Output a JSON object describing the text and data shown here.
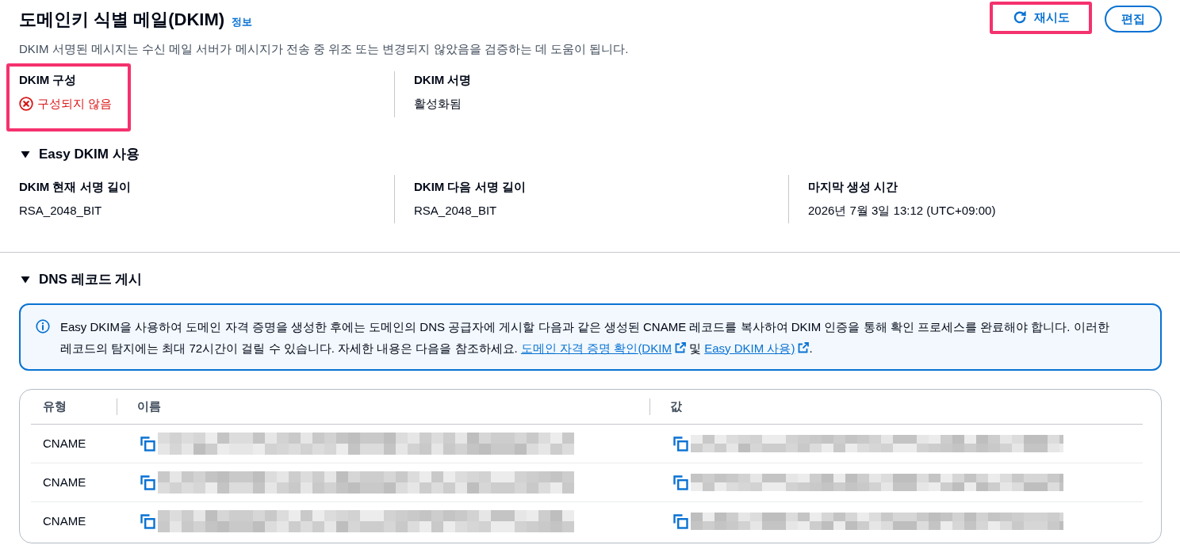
{
  "header": {
    "title": "도메인키 식별 메일(DKIM)",
    "info_link": "정보",
    "description": "DKIM 서명된 메시지는 수신 메일 서버가 메시지가 전송 중 위조 또는 변경되지 않았음을 검증하는 데 도움이 됩니다.",
    "buttons": [
      {
        "label": "재시도",
        "kind": "refresh",
        "highlighted": true
      },
      {
        "label": "편집",
        "kind": "plain",
        "highlighted": false
      }
    ]
  },
  "status_fields": [
    {
      "label": "DKIM 구성",
      "value": "구성되지 않음",
      "kind": "error",
      "highlighted": true
    },
    {
      "label": "DKIM 서명",
      "value": "활성화됨",
      "kind": "plain",
      "highlighted": false
    }
  ],
  "easy_dkim": {
    "title": "Easy DKIM 사용",
    "expanded": true,
    "fields": [
      {
        "label": "DKIM 현재 서명 길이",
        "value": "RSA_2048_BIT"
      },
      {
        "label": "DKIM 다음 서명 길이",
        "value": "RSA_2048_BIT"
      },
      {
        "label": "마지막 생성 시간",
        "value": "2026년 7월 3일 13:12 (UTC+09:00)"
      }
    ]
  },
  "dns_records": {
    "title": "DNS 레코드 게시",
    "expanded": true,
    "alert": {
      "segments": [
        {
          "kind": "text",
          "text": "Easy DKIM을 사용하여 도메인 자격 증명을 생성한 후에는 도메인의 DNS 공급자에 게시할 다음과 같은 생성된 CNAME 레코드를 복사하여 DKIM 인증을 통해 확인 프로세스를 완료해야 합니다. 이러한 레코드의 탐지에는 최대 72시간이 걸릴 수 있습니다. 자세한 내용은 다음을 참조하세요. "
        },
        {
          "kind": "link",
          "text": "도메인 자격 증명 확인(DKIM"
        },
        {
          "kind": "text",
          "text": " 및 "
        },
        {
          "kind": "link",
          "text": "Easy DKIM 사용)"
        },
        {
          "kind": "text",
          "text": "."
        }
      ]
    },
    "table": {
      "columns": [
        "유형",
        "이름",
        "값"
      ],
      "rows": [
        {
          "type": "CNAME",
          "name_redacted": true,
          "value_redacted": true
        },
        {
          "type": "CNAME",
          "name_redacted": true,
          "value_redacted": true
        },
        {
          "type": "CNAME",
          "name_redacted": true,
          "value_redacted": true
        }
      ]
    }
  }
}
